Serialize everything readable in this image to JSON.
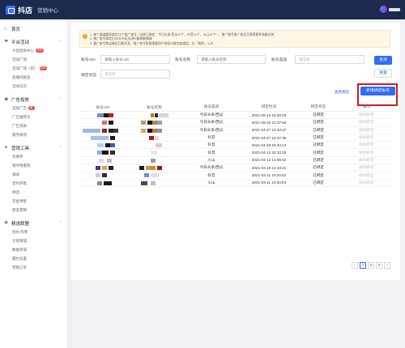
{
  "header": {
    "logo": "抖店",
    "subtitle": "营销中心"
  },
  "sidebar": {
    "home": "首页",
    "groups": [
      {
        "label": "平台活动",
        "items": [
          {
            "label": "大促招商中心",
            "badge": "818"
          },
          {
            "label": "活动广场",
            "badge": ""
          },
          {
            "label": "活动广场（新）",
            "badge": "818"
          },
          {
            "label": "直播间报名",
            "badge": ""
          },
          {
            "label": "活动日历",
            "badge": ""
          }
        ]
      },
      {
        "label": "广告投放",
        "items": [
          {
            "label": "电商广告",
            "badge": "新"
          },
          {
            "label": "广告推荐页",
            "badge": ""
          },
          {
            "label": "广告资质",
            "badge": ""
          },
          {
            "label": "服务商榜",
            "badge": ""
          }
        ]
      },
      {
        "label": "营销工具",
        "items": [
          {
            "label": "优惠券",
            "badge": ""
          },
          {
            "label": "限时限量购",
            "badge": ""
          },
          {
            "label": "满减",
            "badge": ""
          },
          {
            "label": "定时开售",
            "badge": ""
          },
          {
            "label": "拼团",
            "badge": ""
          },
          {
            "label": "定金预售",
            "badge": ""
          },
          {
            "label": "裂变营销",
            "badge": ""
          }
        ]
      },
      {
        "label": "精选联盟",
        "items": [
          {
            "label": "团长/作者",
            "badge": ""
          },
          {
            "label": "计划管理",
            "badge": ""
          },
          {
            "label": "数据参谋",
            "badge": ""
          },
          {
            "label": "履约设置",
            "badge": ""
          },
          {
            "label": "营销订单",
            "badge": ""
          }
        ]
      }
    ]
  },
  "notice": {
    "lines": [
      "1. 每个渠道最多绑定10个推广账号（当前已绑定：今日头条/西瓜10个，抖音10个，火山10个）。推广账号推广商品可获得更多流量扶持",
      "2. 推广账号绑定后30天内无法进行解绑和换绑",
      "3. 推广账号和店铺无归属关系，推广账号权限需要用户授权才能完成绑定，在「我的」入口"
    ]
  },
  "filters": {
    "account_id_label": "账号UID",
    "account_id_placeholder": "请输入账号UID",
    "account_name_label": "账号名称",
    "account_name_placeholder": "请输入账号名称",
    "channel_label": "账号渠道",
    "channel_placeholder": "请选择",
    "status_label": "绑定状态",
    "status_placeholder": "请选择",
    "query_label": "查询",
    "reset_label": "重置"
  },
  "actions": {
    "tutorial_link": "查看教程",
    "add_label": "新增绑定账号"
  },
  "table": {
    "headers": [
      "账号UID",
      "账号名称",
      "账号渠道",
      "绑定时间",
      "绑定状态",
      "操作"
    ],
    "rows": [
      {
        "channel": "今日头条/西瓜",
        "time": "2021-05-13 16:00:03",
        "status": "已绑定",
        "op": "解除绑定"
      },
      {
        "channel": "今日头条/西瓜",
        "time": "2021-05-10 21:37:56",
        "status": "已绑定",
        "op": "解除绑定"
      },
      {
        "channel": "今日头条/西瓜",
        "time": "2021-04-27 14:43:27",
        "status": "已绑定",
        "op": "解除绑定"
      },
      {
        "channel": "抖音",
        "time": "2021-04-27 14:37:35",
        "status": "已绑定",
        "op": "解除绑定"
      },
      {
        "channel": "抖音",
        "time": "2021-04-26 18:34:14",
        "status": "已绑定",
        "op": "解除绑定"
      },
      {
        "channel": "抖音",
        "time": "2021-04-12 22:33:25",
        "status": "已绑定",
        "op": "解除绑定"
      },
      {
        "channel": "火山",
        "time": "2021-04-12 14:59:02",
        "status": "已绑定",
        "op": "解除绑定"
      },
      {
        "channel": "今日头条/西瓜",
        "time": "2021-03-16 14:43:21",
        "status": "已绑定",
        "op": "解除绑定"
      },
      {
        "channel": "抖音",
        "time": "2021-03-11 10:20:53",
        "status": "已绑定",
        "op": "解除绑定"
      },
      {
        "channel": "火山",
        "time": "2021-03-11 10:20:53",
        "status": "已绑定",
        "op": "解除绑定"
      }
    ]
  },
  "pagination": {
    "prev": "‹",
    "pages": [
      "1",
      "2",
      "3"
    ],
    "next": "›",
    "current": "1"
  }
}
